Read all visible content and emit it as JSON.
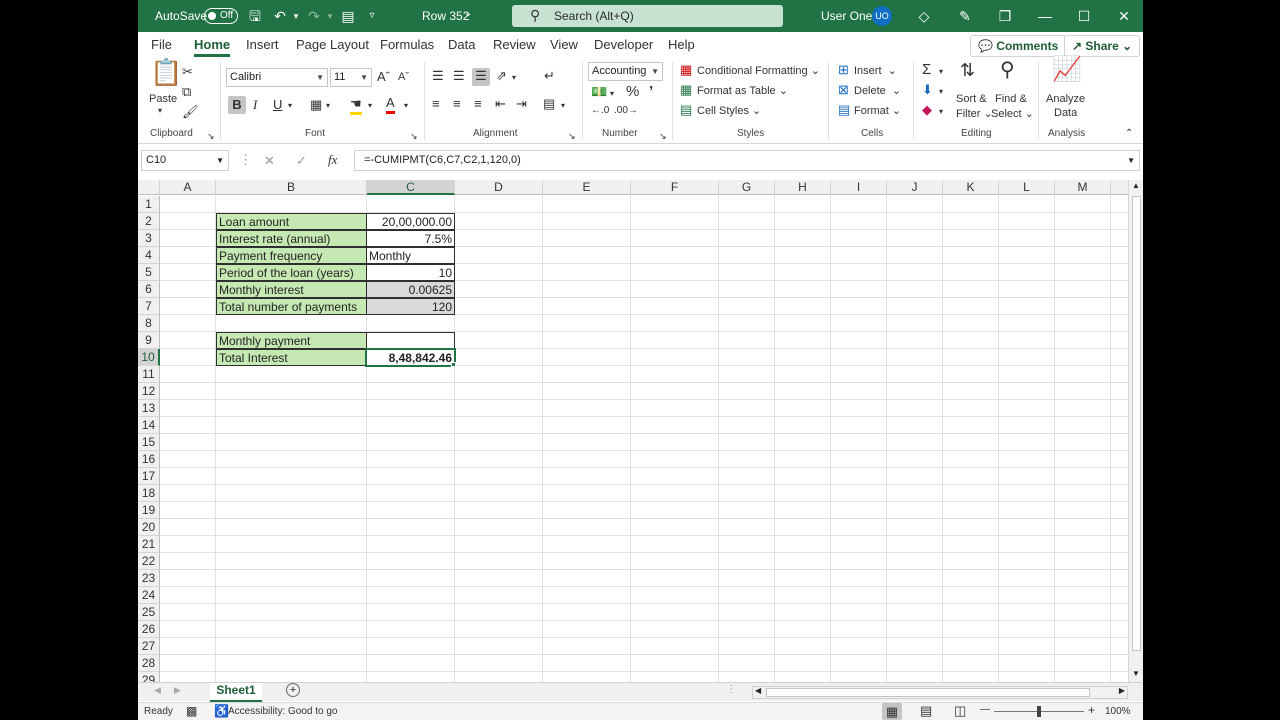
{
  "titlebar": {
    "autosave_label": "AutoSave",
    "autosave_state": "Off",
    "doc_title": "Row 352",
    "search_placeholder": "Search (Alt+Q)",
    "user_name": "User One",
    "user_initials": "UO"
  },
  "tabs": [
    "File",
    "Home",
    "Insert",
    "Page Layout",
    "Formulas",
    "Data",
    "Review",
    "View",
    "Developer",
    "Help"
  ],
  "active_tab": "Home",
  "top_buttons": {
    "comments": "Comments",
    "share": "Share"
  },
  "ribbon": {
    "clipboard": {
      "paste": "Paste",
      "label": "Clipboard"
    },
    "font": {
      "family": "Calibri",
      "size": "11",
      "label": "Font"
    },
    "alignment": {
      "label": "Alignment"
    },
    "number": {
      "format": "Accounting",
      "label": "Number"
    },
    "styles": {
      "conditional": "Conditional Formatting",
      "format_table": "Format as Table",
      "cell_styles": "Cell Styles",
      "label": "Styles"
    },
    "cells": {
      "insert": "Insert",
      "delete": "Delete",
      "format": "Format",
      "label": "Cells"
    },
    "editing": {
      "sort_line1": "Sort &",
      "sort_line2": "Filter",
      "find_line1": "Find &",
      "find_line2": "Select",
      "label": "Editing"
    },
    "analysis": {
      "line1": "Analyze",
      "line2": "Data",
      "label": "Analysis"
    }
  },
  "formula_bar": {
    "name_box": "C10",
    "formula": "=-CUMIPMT(C6,C7,C2,1,120,0)"
  },
  "columns": [
    "A",
    "B",
    "C",
    "D",
    "E",
    "F",
    "G",
    "H",
    "I",
    "J",
    "K",
    "L",
    "M"
  ],
  "rows": [
    "1",
    "2",
    "3",
    "4",
    "5",
    "6",
    "7",
    "8",
    "9",
    "10",
    "11",
    "12",
    "13",
    "14",
    "15",
    "16",
    "17",
    "18",
    "19",
    "20",
    "21",
    "22",
    "23",
    "24",
    "25",
    "26",
    "27",
    "28",
    "29"
  ],
  "cells": {
    "b2": "Loan amount",
    "c2": "20,00,000.00",
    "b3": "Interest rate (annual)",
    "c3": "7.5%",
    "b4": "Payment frequency",
    "c4": "Monthly",
    "b5": "Period of the loan (years)",
    "c5": "10",
    "b6": "Monthly interest",
    "c6": "0.00625",
    "b7": "Total number of payments",
    "c7": "120",
    "b9": "Monthly payment",
    "c9": "",
    "b10": "Total Interest",
    "c10": "8,48,842.46"
  },
  "sheet_tabs": [
    "Sheet1"
  ],
  "status": {
    "ready": "Ready",
    "accessibility": "Accessibility: Good to go",
    "zoom": "100%"
  },
  "colors": {
    "brand": "#217346",
    "label_fill": "#c6e9b4",
    "calc_fill": "#d9d9d9"
  }
}
